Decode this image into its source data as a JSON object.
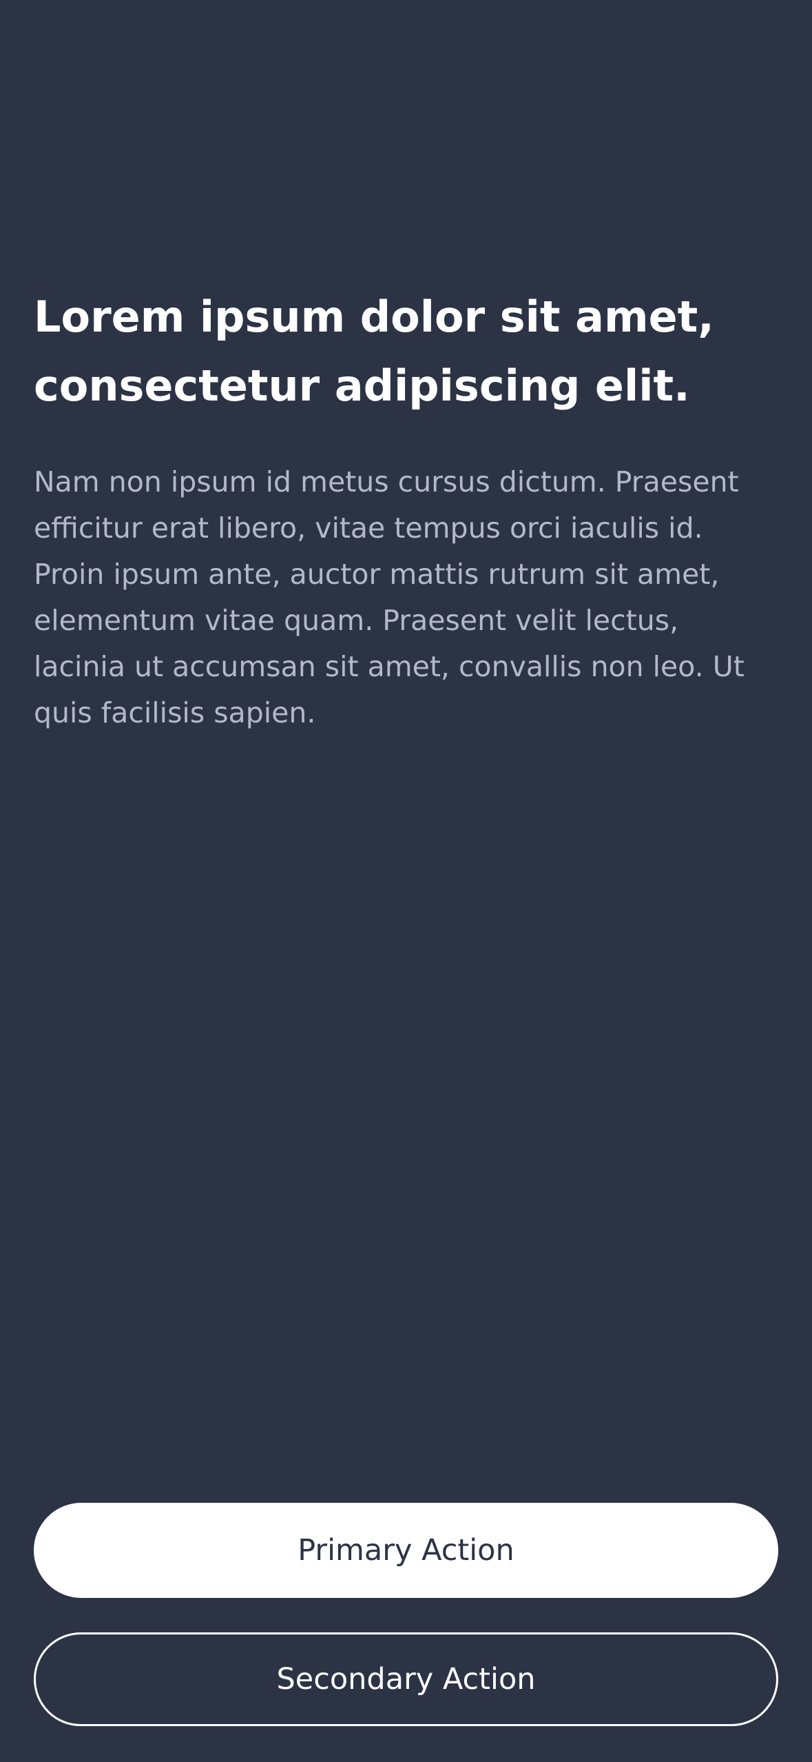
{
  "theme": {
    "background": "#2c3345",
    "headline_color": "#ffffff",
    "body_color": "#b4b9c9",
    "primary_button_bg": "#ffffff",
    "primary_button_text": "#2c3345",
    "secondary_button_border": "#ffffff",
    "secondary_button_text": "#ffffff"
  },
  "content": {
    "headline": "Lorem ipsum dolor sit amet, consectetur adipiscing elit.",
    "body": "Nam non ipsum id metus cursus dictum. Praesent efficitur erat libero, vitae tempus orci iaculis id. Proin ipsum ante, auctor mattis rutrum sit amet, elementum vitae quam. Praesent velit lectus, lacinia ut accumsan sit amet, convallis non leo. Ut quis facilisis sapien."
  },
  "actions": {
    "primary_label": "Primary Action",
    "secondary_label": "Secondary Action"
  }
}
